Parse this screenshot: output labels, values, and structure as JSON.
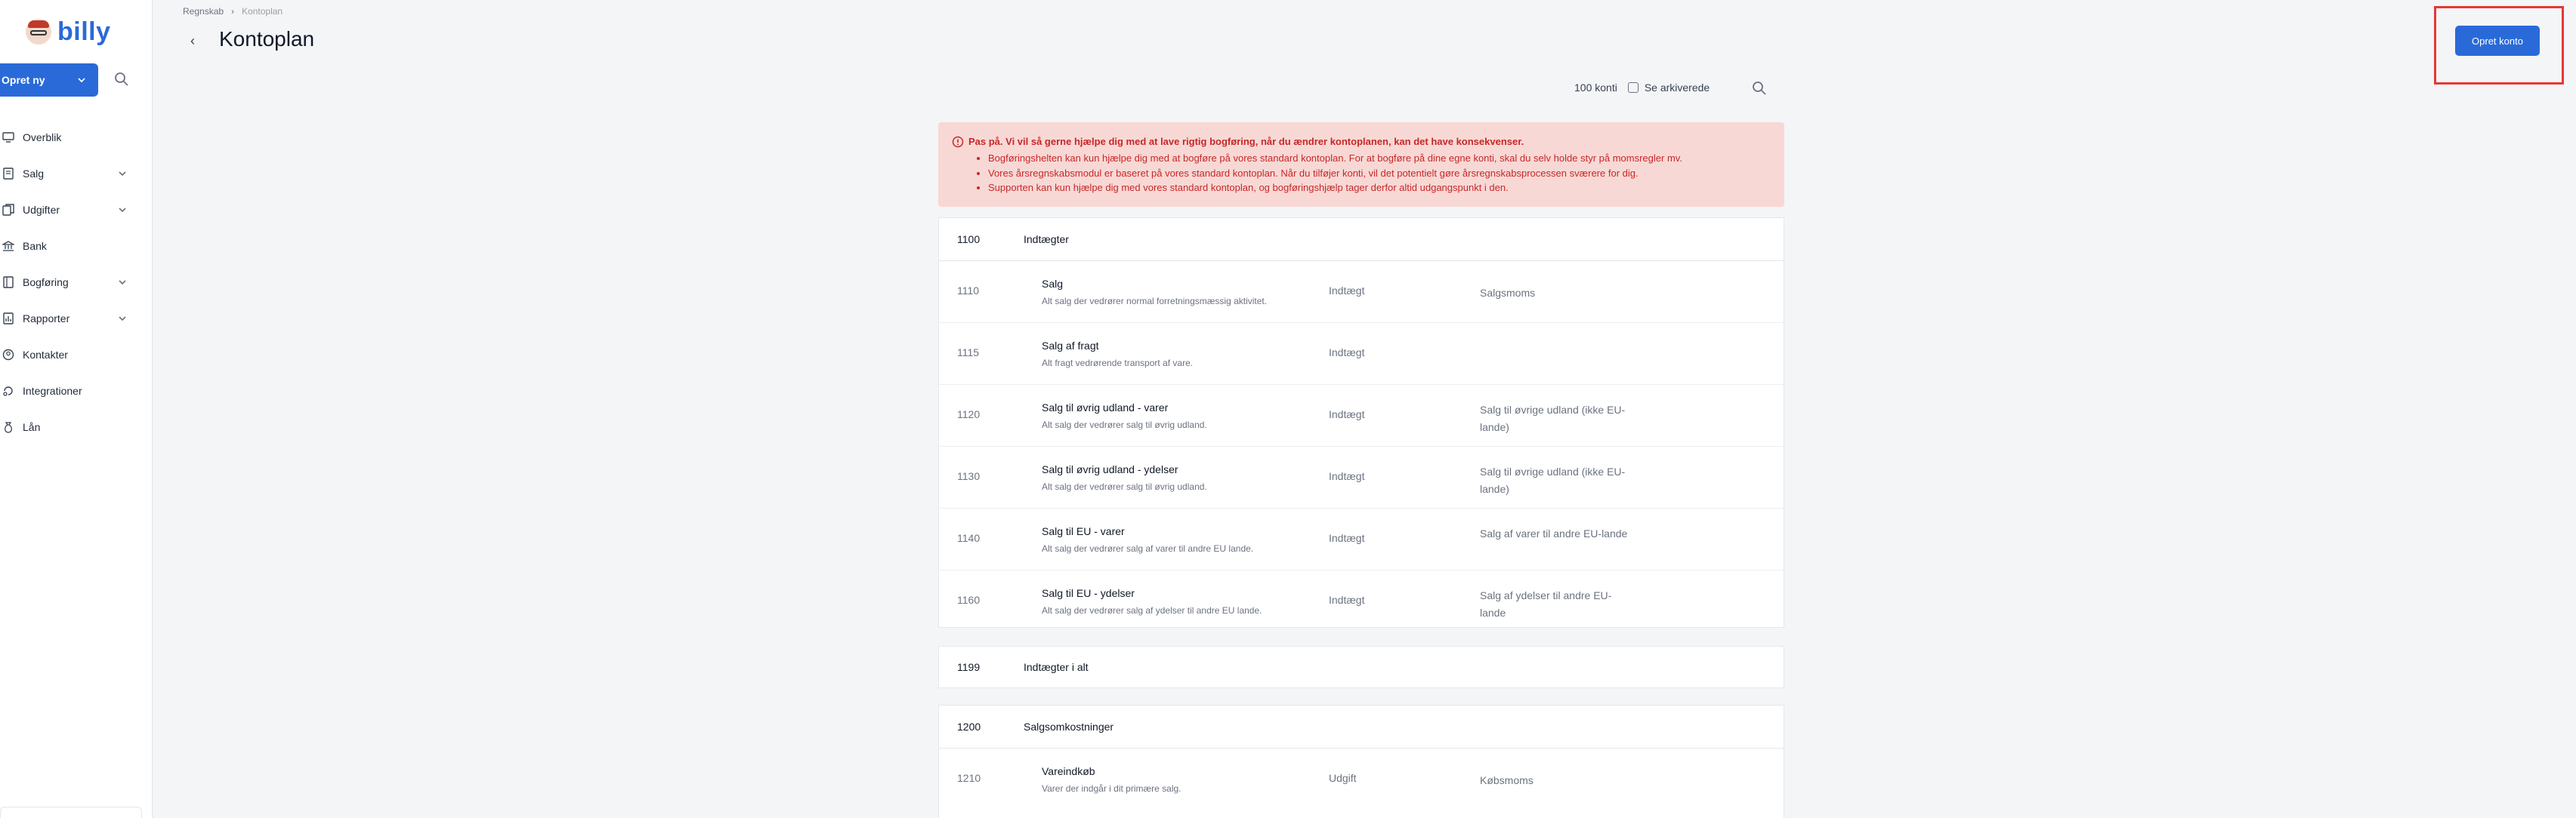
{
  "app": {
    "name": "billy"
  },
  "sidebar": {
    "create_label": "Opret ny",
    "items": [
      {
        "label": "Overblik",
        "icon": "monitor-icon",
        "has_chevron": false
      },
      {
        "label": "Salg",
        "icon": "receipt-icon",
        "has_chevron": true
      },
      {
        "label": "Udgifter",
        "icon": "documents-icon",
        "has_chevron": true
      },
      {
        "label": "Bank",
        "icon": "bank-icon",
        "has_chevron": false
      },
      {
        "label": "Bogføring",
        "icon": "ledger-icon",
        "has_chevron": true
      },
      {
        "label": "Rapporter",
        "icon": "report-icon",
        "has_chevron": true
      },
      {
        "label": "Kontakter",
        "icon": "contacts-icon",
        "has_chevron": false
      },
      {
        "label": "Integrationer",
        "icon": "integrations-icon",
        "has_chevron": false
      },
      {
        "label": "Lån",
        "icon": "loan-icon",
        "has_chevron": false
      }
    ]
  },
  "header": {
    "breadcrumb": [
      "Regnskab",
      "Kontoplan"
    ],
    "title": "Kontoplan",
    "create_button": "Opret konto"
  },
  "toolbar": {
    "count": "100 konti",
    "archived_label": "Se arkiverede"
  },
  "alert": {
    "title": "Pas på. Vi vil så gerne hjælpe dig med at lave rigtig bogføring, når du ændrer kontoplanen, kan det have konsekvenser.",
    "bullets": [
      "Bogføringshelten kan kun hjælpe dig med at bogføre på vores standard kontoplan. For at bogføre på dine egne konti, skal du selv holde styr på momsregler mv.",
      "Vores årsregnskabsmodul er baseret på vores standard kontoplan. Når du tilføjer konti, vil det potentielt gøre årsregnskabsprocessen sværere for dig.",
      "Supporten kan kun hjælpe dig med vores standard kontoplan, og bogføringshjælp tager derfor altid udgangspunkt i den."
    ]
  },
  "groups": [
    {
      "number": "1100",
      "name": "Indtægter",
      "rows": [
        {
          "number": "1110",
          "name": "Salg",
          "desc": "Alt salg der vedrører normal forretningsmæssig aktivitet.",
          "type": "Indtægt",
          "vat": "Salgsmoms"
        },
        {
          "number": "1115",
          "name": "Salg af fragt",
          "desc": "Alt fragt vedrørende transport af vare.",
          "type": "Indtægt",
          "vat": ""
        },
        {
          "number": "1120",
          "name": "Salg til øvrig udland - varer",
          "desc": "Alt salg der vedrører salg til øvrig udland.",
          "type": "Indtægt",
          "vat": "Salg til øvrige udland (ikke EU-lande)"
        },
        {
          "number": "1130",
          "name": "Salg til øvrig udland - ydelser",
          "desc": "Alt salg der vedrører salg til øvrig udland.",
          "type": "Indtægt",
          "vat": "Salg til øvrige udland (ikke EU-lande)"
        },
        {
          "number": "1140",
          "name": "Salg til EU - varer",
          "desc": "Alt salg der vedrører salg af varer til andre EU lande.",
          "type": "Indtægt",
          "vat": "Salg af varer til andre EU-lande"
        },
        {
          "number": "1160",
          "name": "Salg til EU - ydelser",
          "desc": "Alt salg der vedrører salg af ydelser til andre EU lande.",
          "type": "Indtægt",
          "vat": "Salg af ydelser til andre EU-lande"
        }
      ]
    },
    {
      "number": "1199",
      "name": "Indtægter i alt",
      "rows": []
    },
    {
      "number": "1200",
      "name": "Salgsomkostninger",
      "rows": [
        {
          "number": "1210",
          "name": "Vareindkøb",
          "desc": "Varer der indgår i dit primære salg.",
          "type": "Udgift",
          "vat": "Købsmoms"
        },
        {
          "number": "",
          "name": "",
          "desc": "",
          "type": "",
          "vat": ""
        }
      ]
    }
  ],
  "colors": {
    "accent": "#2a6ad8",
    "alert_bg": "#f8d8d5",
    "alert_text": "#c62828",
    "highlight": "#e53935"
  }
}
